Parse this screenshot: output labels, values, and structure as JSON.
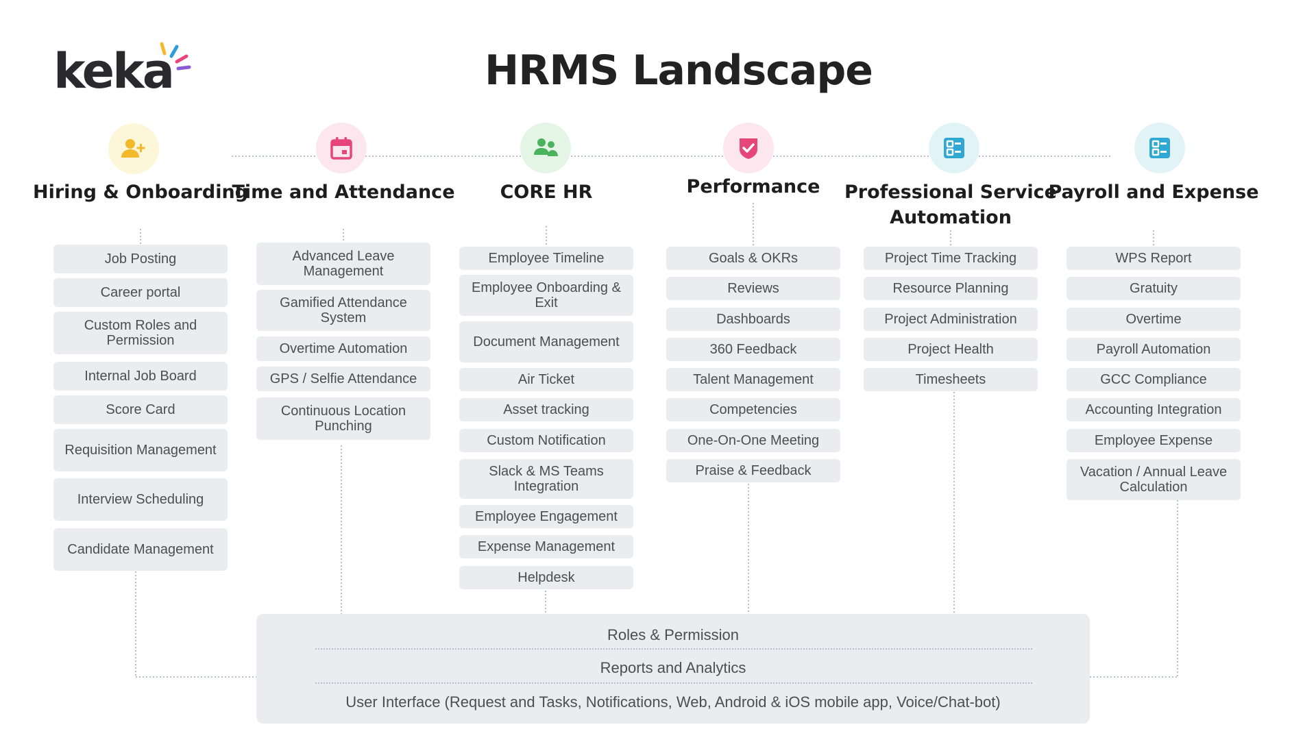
{
  "title": "HRMS Landscape",
  "logo": {
    "text": "keka",
    "ray_colors": [
      "#f5b82e",
      "#2e9bd6",
      "#e8457a",
      "#8b5bd6"
    ]
  },
  "columns": [
    {
      "title": "Hiring & Onboarding",
      "icon": "person-add-icon",
      "icon_bg": "#fdf6d8",
      "icon_color": "#f2b92b",
      "items": [
        "Job Posting",
        "Career portal",
        "Custom Roles and Permission",
        "Internal Job Board",
        "Score Card",
        "Requisition Management",
        "Interview Scheduling",
        "Candidate Management"
      ]
    },
    {
      "title": "Time and Attendance",
      "icon": "calendar-icon",
      "icon_bg": "#fde6ee",
      "icon_color": "#e6457a",
      "items": [
        "Advanced Leave Management",
        "Gamified Attendance System",
        "Overtime Automation",
        "GPS / Selfie Attendance",
        "Continuous Location Punching"
      ]
    },
    {
      "title": "CORE HR",
      "icon": "people-icon",
      "icon_bg": "#e4f5e6",
      "icon_color": "#4bb35d",
      "items": [
        "Employee Timeline",
        "Employee Onboarding & Exit",
        "Document Management",
        "Air Ticket",
        "Asset tracking",
        "Custom Notification",
        "Slack & MS Teams Integration",
        "Employee Engagement",
        "Expense Management",
        "Helpdesk"
      ]
    },
    {
      "title": "Performance",
      "icon": "shield-check-icon",
      "icon_bg": "#fde6ee",
      "icon_color": "#e6457a",
      "items": [
        "Goals & OKRs",
        "Reviews",
        "Dashboards",
        "360 Feedback",
        "Talent Management",
        "Competencies",
        "One-On-One Meeting",
        "Praise & Feedback"
      ]
    },
    {
      "title": "Professional Service Automation",
      "icon": "checklist-icon",
      "icon_bg": "#e2f3f8",
      "icon_color": "#2fa9d4",
      "items": [
        "Project Time Tracking",
        "Resource Planning",
        "Project Administration",
        "Project Health",
        "Timesheets"
      ]
    },
    {
      "title": "Payroll and Expense",
      "icon": "checklist-icon",
      "icon_bg": "#e2f3f8",
      "icon_color": "#2fa9d4",
      "items": [
        "WPS Report",
        "Gratuity",
        "Overtime",
        "Payroll Automation",
        "GCC Compliance",
        "Accounting Integration",
        "Employee Expense",
        "Vacation / Annual Leave Calculation"
      ]
    }
  ],
  "foundation": [
    "Roles & Permission",
    "Reports and Analytics",
    "User Interface (Request and Tasks, Notifications, Web, Android & iOS mobile app, Voice/Chat-bot)"
  ]
}
